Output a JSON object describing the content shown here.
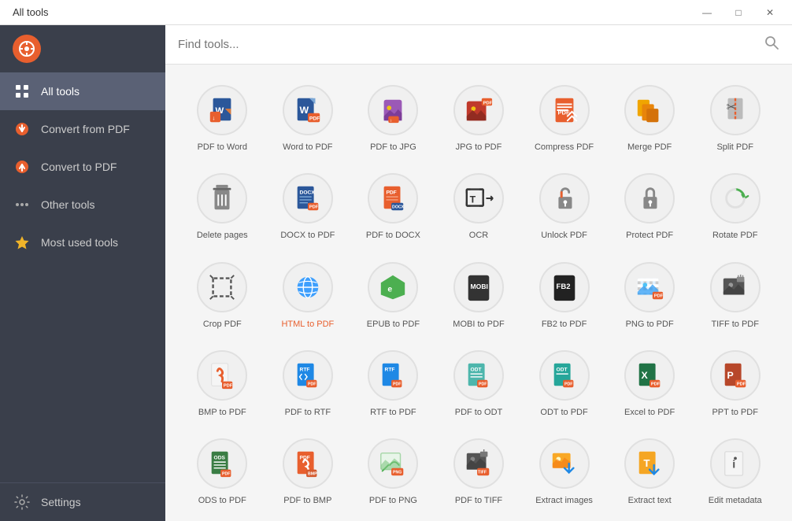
{
  "titleBar": {
    "title": "All tools",
    "minimize": "—",
    "maximize": "□",
    "close": "✕"
  },
  "sidebar": {
    "logo": "❀",
    "items": [
      {
        "id": "all-tools",
        "label": "All tools",
        "active": true,
        "icon": "grid"
      },
      {
        "id": "convert-from-pdf",
        "label": "Convert from PDF",
        "active": false,
        "icon": "arrow-down"
      },
      {
        "id": "convert-to-pdf",
        "label": "Convert to PDF",
        "active": false,
        "icon": "arrow-up"
      },
      {
        "id": "other-tools",
        "label": "Other tools",
        "active": false,
        "icon": "dots"
      },
      {
        "id": "most-used",
        "label": "Most used tools",
        "active": false,
        "icon": "star"
      }
    ],
    "settings": "Settings"
  },
  "search": {
    "placeholder": "Find tools..."
  },
  "tools": [
    {
      "id": "pdf-to-word",
      "label": "PDF to Word"
    },
    {
      "id": "word-to-pdf",
      "label": "Word to PDF"
    },
    {
      "id": "pdf-to-jpg",
      "label": "PDF to JPG"
    },
    {
      "id": "jpg-to-pdf",
      "label": "JPG to PDF"
    },
    {
      "id": "compress-pdf",
      "label": "Compress PDF"
    },
    {
      "id": "merge-pdf",
      "label": "Merge PDF"
    },
    {
      "id": "split-pdf",
      "label": "Split PDF"
    },
    {
      "id": "delete-pages",
      "label": "Delete pages"
    },
    {
      "id": "docx-to-pdf",
      "label": "DOCX to PDF"
    },
    {
      "id": "pdf-to-docx",
      "label": "PDF to DOCX"
    },
    {
      "id": "ocr",
      "label": "OCR"
    },
    {
      "id": "unlock-pdf",
      "label": "Unlock PDF"
    },
    {
      "id": "protect-pdf",
      "label": "Protect PDF"
    },
    {
      "id": "rotate-pdf",
      "label": "Rotate PDF"
    },
    {
      "id": "crop-pdf",
      "label": "Crop PDF"
    },
    {
      "id": "html-to-pdf",
      "label": "HTML to PDF",
      "red": true
    },
    {
      "id": "epub-to-pdf",
      "label": "EPUB to PDF"
    },
    {
      "id": "mobi-to-pdf",
      "label": "MOBI to PDF"
    },
    {
      "id": "fb2-to-pdf",
      "label": "FB2 to PDF"
    },
    {
      "id": "png-to-pdf",
      "label": "PNG to PDF"
    },
    {
      "id": "tiff-to-pdf",
      "label": "TIFF to PDF"
    },
    {
      "id": "bmp-to-pdf",
      "label": "BMP to PDF"
    },
    {
      "id": "pdf-to-rtf",
      "label": "PDF to RTF"
    },
    {
      "id": "rtf-to-pdf",
      "label": "RTF to PDF"
    },
    {
      "id": "pdf-to-odt",
      "label": "PDF to ODT"
    },
    {
      "id": "odt-to-pdf",
      "label": "ODT to PDF"
    },
    {
      "id": "excel-to-pdf",
      "label": "Excel to PDF"
    },
    {
      "id": "ppt-to-pdf",
      "label": "PPT to PDF"
    },
    {
      "id": "ods-to-pdf",
      "label": "ODS to PDF"
    },
    {
      "id": "pdf-to-bmp",
      "label": "PDF to BMP"
    },
    {
      "id": "pdf-to-png",
      "label": "PDF to PNG"
    },
    {
      "id": "pdf-to-tiff",
      "label": "PDF to TIFF"
    },
    {
      "id": "extract-images",
      "label": "Extract images"
    },
    {
      "id": "extract-text",
      "label": "Extract text"
    },
    {
      "id": "edit-metadata",
      "label": "Edit metadata"
    }
  ]
}
